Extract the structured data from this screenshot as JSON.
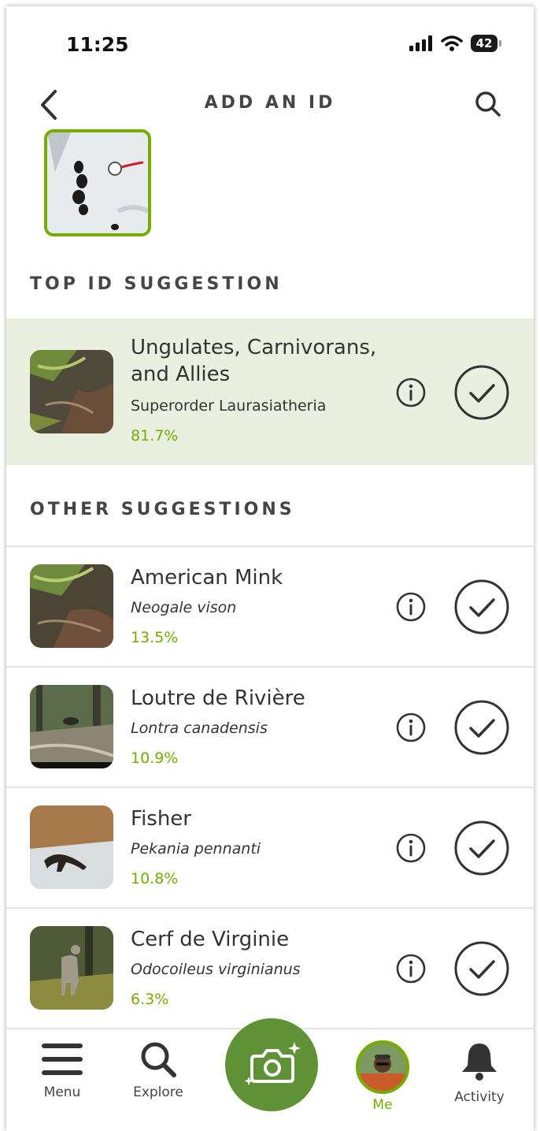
{
  "status_bar": {
    "time": "11:25",
    "battery": "42"
  },
  "header": {
    "title": "ADD AN ID"
  },
  "sections": {
    "top_title": "TOP ID SUGGESTION",
    "other_title": "OTHER SUGGESTIONS"
  },
  "top_suggestion": {
    "name": "Ungulates, Carnivorans, and Allies",
    "name_line1": "Ungulates, Carnivorans,",
    "name_line2": "and Allies",
    "scientific": "Superorder Laurasiatheria",
    "score": "81.7%"
  },
  "suggestions": [
    {
      "name": "American Mink",
      "scientific": "Neogale vison",
      "score": "13.5%"
    },
    {
      "name": "Loutre de Rivière",
      "scientific": "Lontra canadensis",
      "score": "10.9%"
    },
    {
      "name": "Fisher",
      "scientific": "Pekania pennanti",
      "score": "10.8%"
    },
    {
      "name": "Cerf de Virginie",
      "scientific": "Odocoileus virginianus",
      "score": "6.3%"
    }
  ],
  "tabbar": {
    "menu": "Menu",
    "explore": "Explore",
    "me": "Me",
    "activity": "Activity"
  },
  "colors": {
    "accent": "#74ac00",
    "camera": "#5f9236",
    "top_row_bg": "#e9f0df",
    "text": "#454545"
  },
  "icons": {
    "back": "chevron-left-icon",
    "search": "search-icon",
    "info": "info-icon",
    "check": "check-circle-icon",
    "menu": "hamburger-icon",
    "explore": "search-icon",
    "camera": "camera-sparkle-icon",
    "activity": "bell-icon"
  }
}
